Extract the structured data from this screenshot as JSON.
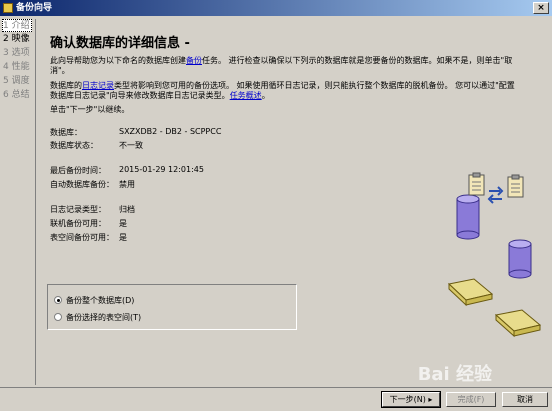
{
  "window": {
    "title": "备份向导",
    "close_glyph": "×"
  },
  "steps": [
    {
      "label": "1 介绍",
      "state": "current"
    },
    {
      "label": "2 映像",
      "state": "active"
    },
    {
      "label": "3 选项",
      "state": "disabled"
    },
    {
      "label": "4 性能",
      "state": "disabled"
    },
    {
      "label": "5 调度",
      "state": "disabled"
    },
    {
      "label": "6 总结",
      "state": "disabled"
    }
  ],
  "main": {
    "heading": "确认数据库的详细信息 -",
    "intro_a": "此向导帮助您为以下命名的数据库创建",
    "intro_link": "备份",
    "intro_b": "任务。 进行检查以确保以下列示的数据库就是您要备份的数据库。如果不是，则单击\"取",
    "intro_c": "消\"。",
    "log_a": "数据库的",
    "log_link": "日志记录",
    "log_b": "类型将影响到您可用的备份选项。 如果使用循环日志记录，则只能执行整个数据库的脱机备份。 您可以通过\"配置",
    "log_c": "数据库日志记录\"向导来修改数据库日志记录类型。",
    "log_link2": "任务概述",
    "log_d": "。",
    "next_hint": "单击\"下一步\"以继续。"
  },
  "details": {
    "db_label": "数据库：",
    "db_value": "SXZXDB2 - DB2 - SCPPCC",
    "state_label": "数据库状态：",
    "state_value": "不一致",
    "last_label": "最后备份时间：",
    "last_value": "2015-01-29 12:01:45",
    "auto_label": "自动数据库备份：",
    "auto_value": "禁用",
    "logtype_label": "日志记录类型：",
    "logtype_value": "归档",
    "online_label": "联机备份可用：",
    "online_value": "是",
    "tbs_label": "表空间备份可用：",
    "tbs_value": "是"
  },
  "options": {
    "whole": "备份整个数据库(D)",
    "selected": "备份选择的表空间(T)",
    "selected_index": 0
  },
  "buttons": {
    "next": "下一步(N) ▸",
    "finish": "完成(F)",
    "cancel": "取消"
  },
  "watermark": "Bai 经验",
  "colors": {
    "accent": "#0a246a",
    "link": "#0000cc",
    "cylinder": "#8a7ad8"
  }
}
